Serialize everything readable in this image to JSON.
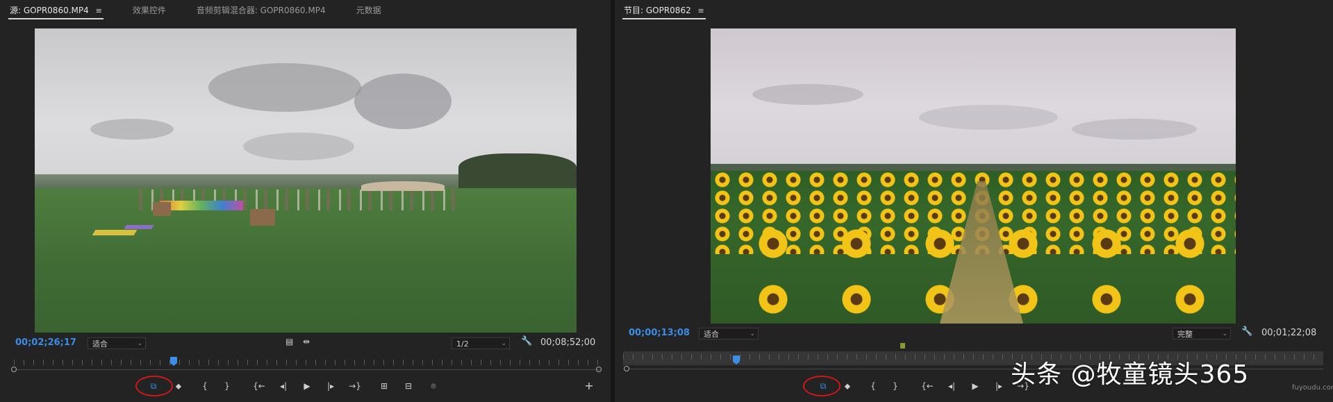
{
  "source_monitor": {
    "tabs": [
      {
        "label": "源: GOPR0860.MP4",
        "active": true
      },
      {
        "label": "效果控件",
        "active": false
      },
      {
        "label": "音频剪辑混合器: GOPR0860.MP4",
        "active": false
      },
      {
        "label": "元数据",
        "active": false
      }
    ],
    "menu_icon": "≡",
    "timecode_current": "00;02;26;17",
    "zoom_value": "适合",
    "resolution_value": "1/2",
    "timecode_duration": "00;08;52;00",
    "controls": {
      "insert_overwrite_icon": "⧉",
      "marker_icon": "⬥",
      "mark_in": "{",
      "mark_out": "}",
      "go_to_in": "{←",
      "step_back": "◂|",
      "play": "▶",
      "step_forward": "|▸",
      "go_to_out": "→}",
      "insert": "⊞",
      "overlay": "⊟",
      "export_frame_icon": "⌾"
    },
    "add_button": "+",
    "playhead_fraction": 0.27
  },
  "program_monitor": {
    "tab_label": "节目: GOPR0862",
    "menu_icon": "≡",
    "timecode_current": "00;00;13;08",
    "zoom_value": "适合",
    "resolution_value": "完整",
    "timecode_duration": "00;01;22;08",
    "playhead_fraction": 0.16,
    "in_marker_fraction": 0.4
  },
  "watermark": {
    "main": "头条 @牧童镜头365",
    "sub": "fuyoudu.com"
  },
  "colors": {
    "accent_blue": "#3a8ee6",
    "annotation_red": "#d01818",
    "panel_bg": "#232323"
  }
}
